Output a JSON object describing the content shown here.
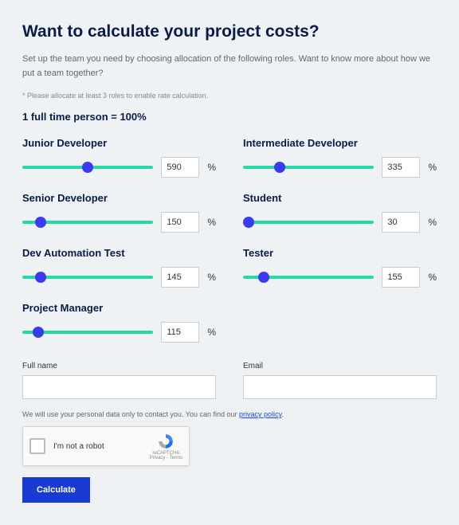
{
  "title": "Want to calculate your project costs?",
  "intro": "Set up the team you need by choosing allocation of the following roles. Want to know more about how we put a team together?",
  "note": "* Please allocate at least 3 roles to enable rate calculation.",
  "equivalence": "1 full time person = 100%",
  "percent_symbol": "%",
  "roles": [
    {
      "label": "Junior Developer",
      "value": "590",
      "thumb_pct": 50
    },
    {
      "label": "Intermediate Developer",
      "value": "335",
      "thumb_pct": 28
    },
    {
      "label": "Senior Developer",
      "value": "150",
      "thumb_pct": 14
    },
    {
      "label": "Student",
      "value": "30",
      "thumb_pct": 4
    },
    {
      "label": "Dev Automation Test",
      "value": "145",
      "thumb_pct": 14
    },
    {
      "label": "Tester",
      "value": "155",
      "thumb_pct": 16
    },
    {
      "label": "Project Manager",
      "value": "115",
      "thumb_pct": 12
    }
  ],
  "fields": {
    "fullname_label": "Full name",
    "email_label": "Email"
  },
  "privacy_text_pre": "We will use your personal data only to contact you. You can find our ",
  "privacy_link": "privacy policy",
  "privacy_text_post": ".",
  "captcha": {
    "label": "I'm not a robot",
    "brand": "reCAPTCHA",
    "terms": "Privacy - Terms"
  },
  "calculate_label": "Calculate"
}
